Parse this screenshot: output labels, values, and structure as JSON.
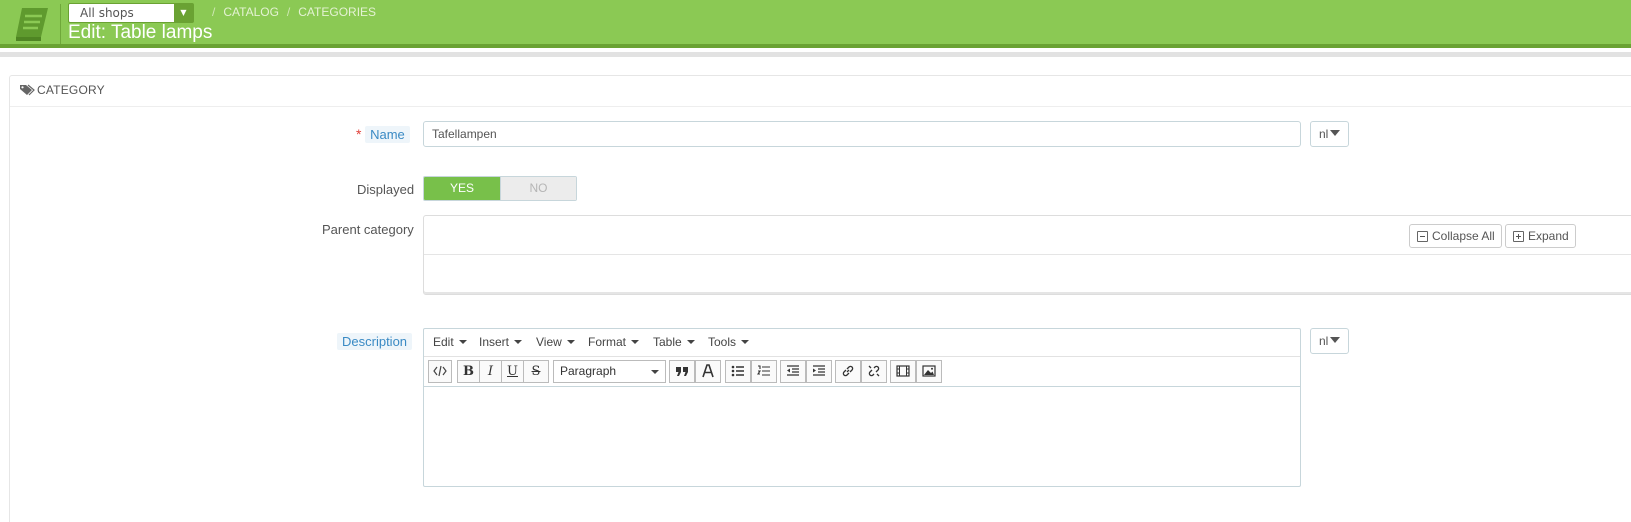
{
  "header": {
    "shop_select": "All shops",
    "breadcrumb": [
      "CATALOG",
      "CATEGORIES"
    ],
    "title": "Edit: Table lamps",
    "colors": {
      "bar": "#8bc954",
      "bar_dark": "#6aa233"
    }
  },
  "panel": {
    "heading": "CATEGORY",
    "icon": "tag-icon"
  },
  "form": {
    "name_label": "Name",
    "required_mark": "*",
    "name_value": "Tafellampen",
    "lang": "nl",
    "displayed_label": "Displayed",
    "yes": "YES",
    "no": "NO",
    "parent_label": "Parent category",
    "collapse_all": "Collapse All",
    "expand_all": "Expand",
    "description_label": "Description",
    "description_lang": "nl"
  },
  "editor": {
    "menus": [
      "Edit",
      "Insert",
      "View",
      "Format",
      "Table",
      "Tools"
    ],
    "paragraph": "Paragraph",
    "buttons": [
      "source-code-icon",
      "bold-icon",
      "italic-icon",
      "underline-icon",
      "strikethrough-icon",
      "blockquote-icon",
      "text-color-icon",
      "bullet-list-icon",
      "numbered-list-icon",
      "outdent-icon",
      "indent-icon",
      "link-icon",
      "unlink-icon",
      "media-icon",
      "image-icon"
    ],
    "bold": "B",
    "italic": "I",
    "underline": "U",
    "strike": "S"
  }
}
